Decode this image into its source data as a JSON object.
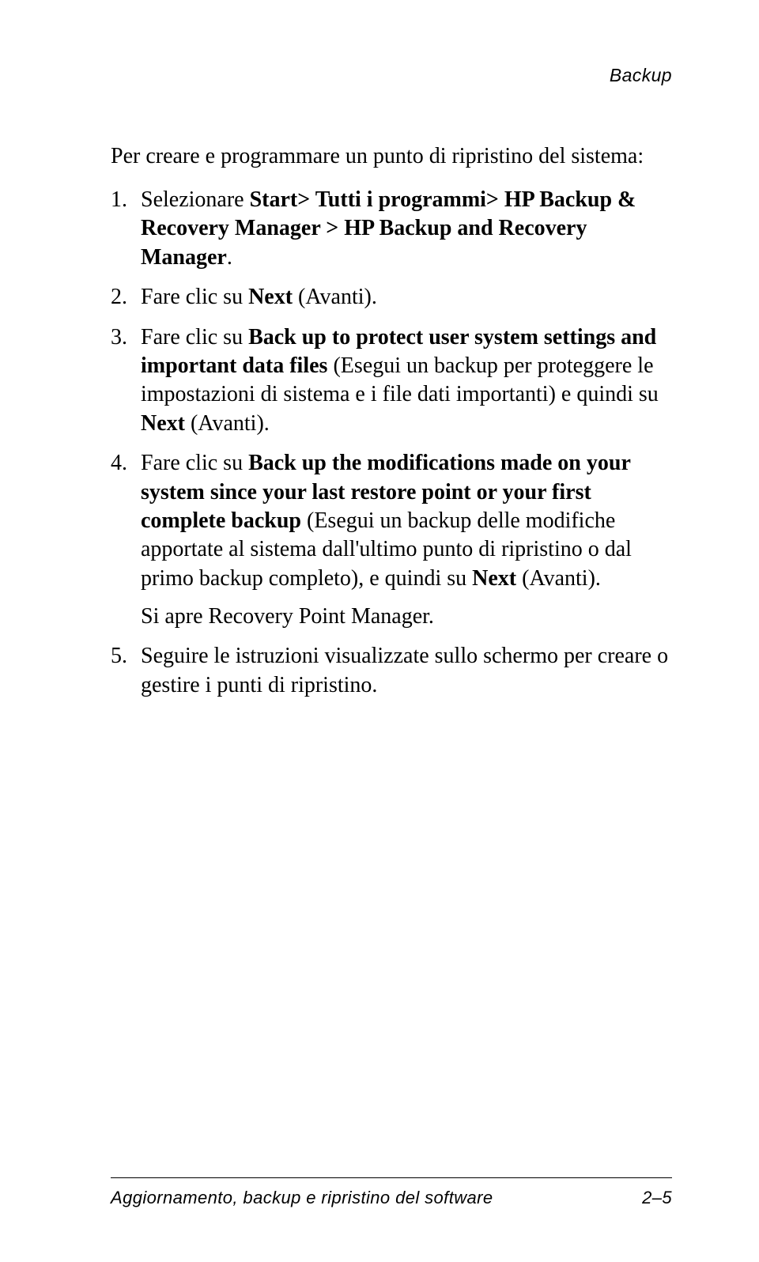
{
  "header": {
    "section": "Backup"
  },
  "content": {
    "intro": "Per creare e programmare un punto di ripristino del sistema:",
    "step1": {
      "pre": "Selezionare ",
      "bold1": "Start> Tutti i programmi> HP Backup & Recovery Manager > HP Backup and Recovery Manager",
      "post": "."
    },
    "step2": {
      "pre": "Fare clic su ",
      "bold1": "Next",
      "post": " (Avanti)."
    },
    "step3": {
      "pre": "Fare clic su ",
      "bold1": "Back up to protect user system settings and important data files",
      "mid": " (Esegui un backup per proteggere le impostazioni di sistema e i file dati importanti) e quindi su ",
      "bold2": "Next",
      "post": " (Avanti)."
    },
    "step4": {
      "pre": "Fare clic su ",
      "bold1": "Back up the modifications made on your system since your last restore point or your first complete backup",
      "mid": " (Esegui un backup delle modifiche apportate al sistema dall'ultimo punto di ripristino o dal primo backup completo), e quindi su ",
      "bold2": "Next",
      "post": " (Avanti).",
      "sub": "Si apre Recovery Point Manager."
    },
    "step5": {
      "text": "Seguire le istruzioni visualizzate sullo schermo per creare o gestire i punti di ripristino."
    }
  },
  "footer": {
    "left": "Aggiornamento, backup e ripristino del software",
    "right": "2–5"
  }
}
